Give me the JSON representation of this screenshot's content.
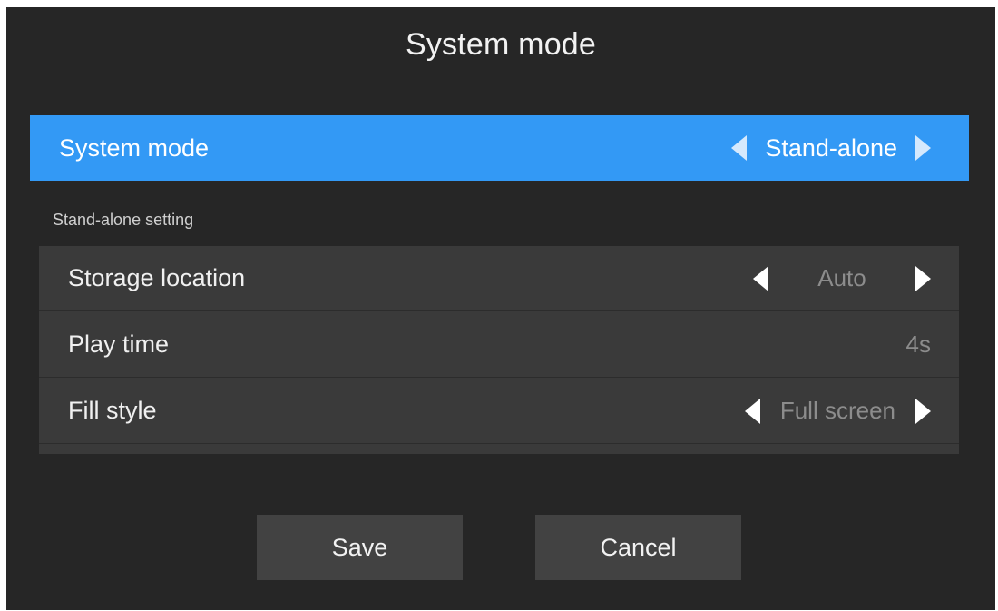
{
  "dialog": {
    "title": "System mode"
  },
  "system_mode": {
    "label": "System mode",
    "value": "Stand-alone"
  },
  "section": {
    "label": "Stand-alone setting"
  },
  "settings": [
    {
      "label": "Storage location",
      "value": "Auto",
      "type": "selector"
    },
    {
      "label": "Play time",
      "value": "4s",
      "type": "value"
    },
    {
      "label": "Fill style",
      "value": "Full screen",
      "type": "selector"
    }
  ],
  "buttons": {
    "save": "Save",
    "cancel": "Cancel"
  },
  "colors": {
    "background": "#262626",
    "highlight": "#3399f5",
    "list_background": "#3a3a3a",
    "button_background": "#424242",
    "value_text": "#8c8c8c"
  },
  "icons": {
    "previous": "left-arrow-icon",
    "next": "right-arrow-icon"
  }
}
